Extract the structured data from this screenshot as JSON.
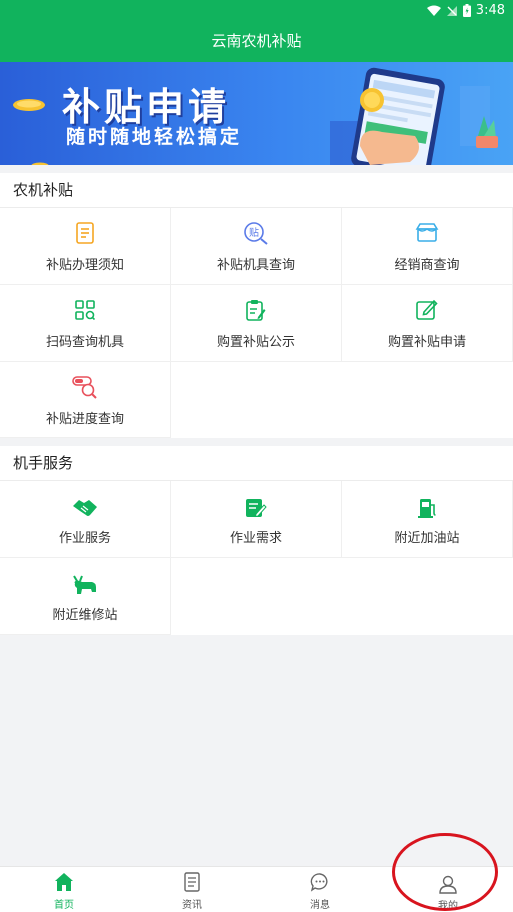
{
  "status_bar": {
    "time": "3:48"
  },
  "header": {
    "title": "云南农机补贴"
  },
  "banner": {
    "title": "补贴申请",
    "subtitle": "随时随地轻松搞定"
  },
  "subsidy_section": {
    "title": "农机补贴",
    "items": [
      {
        "label": "补贴办理须知",
        "icon": "document-list-icon",
        "color": "#f5a623"
      },
      {
        "label": "补贴机具查询",
        "icon": "search-subsidy-icon",
        "color": "#5b7be8"
      },
      {
        "label": "经销商查询",
        "icon": "store-icon",
        "color": "#3aaee8"
      },
      {
        "label": "扫码查询机具",
        "icon": "scan-grid-icon",
        "color": "#11b35d"
      },
      {
        "label": "购置补贴公示",
        "icon": "clipboard-edit-icon",
        "color": "#11b35d"
      },
      {
        "label": "购置补贴申请",
        "icon": "edit-square-icon",
        "color": "#11b35d"
      },
      {
        "label": "补贴进度查询",
        "icon": "progress-search-icon",
        "color": "#e8505b"
      }
    ]
  },
  "operator_section": {
    "title": "机手服务",
    "items": [
      {
        "label": "作业服务",
        "icon": "handshake-icon",
        "color": "#11b35d"
      },
      {
        "label": "作业需求",
        "icon": "edit-note-icon",
        "color": "#11b35d"
      },
      {
        "label": "附近加油站",
        "icon": "fuel-station-icon",
        "color": "#11b35d"
      },
      {
        "label": "附近维修站",
        "icon": "repair-cow-icon",
        "color": "#11b35d"
      }
    ]
  },
  "tabbar": {
    "items": [
      {
        "label": "首页",
        "icon": "home-icon",
        "active": true
      },
      {
        "label": "资讯",
        "icon": "news-icon",
        "active": false
      },
      {
        "label": "消息",
        "icon": "message-icon",
        "active": false
      },
      {
        "label": "我的",
        "icon": "user-icon",
        "active": false
      }
    ]
  },
  "colors": {
    "primary": "#11b35d",
    "background": "#f2f3f5",
    "annotation": "#d8141e"
  }
}
